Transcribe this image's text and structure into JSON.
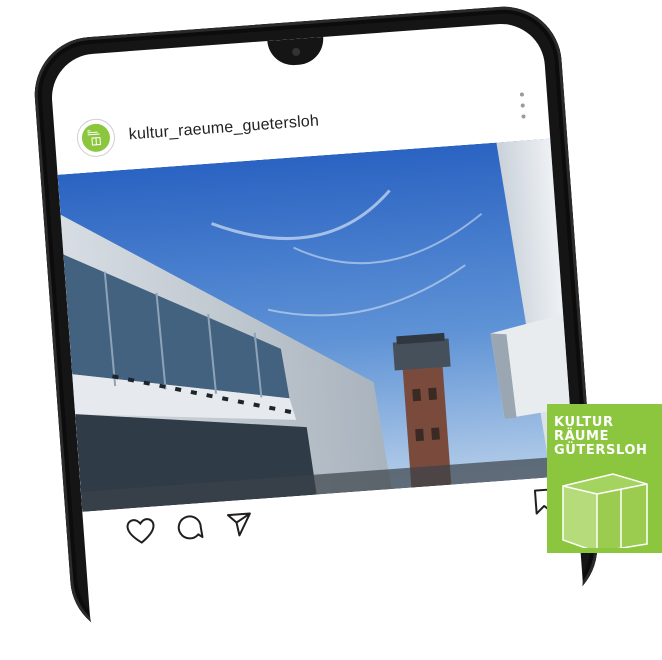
{
  "post": {
    "username": "kultur_raeume_guetersloh",
    "avatar_text": "KULTUR RÄUME GÜTERSLOH"
  },
  "actions": {
    "like_icon": "heart-outline-icon",
    "comment_icon": "comment-bubble-icon",
    "share_icon": "paper-plane-icon",
    "save_icon": "bookmark-icon"
  },
  "badge": {
    "line1": "KULTUR",
    "line2": "RÄUME",
    "line3": "GÜTERSLOH"
  },
  "colors": {
    "brand_green": "#8cc63f",
    "phone_frame": "#151515",
    "sky_top": "#2a63c2",
    "sky_bottom": "#b7cfe9"
  }
}
